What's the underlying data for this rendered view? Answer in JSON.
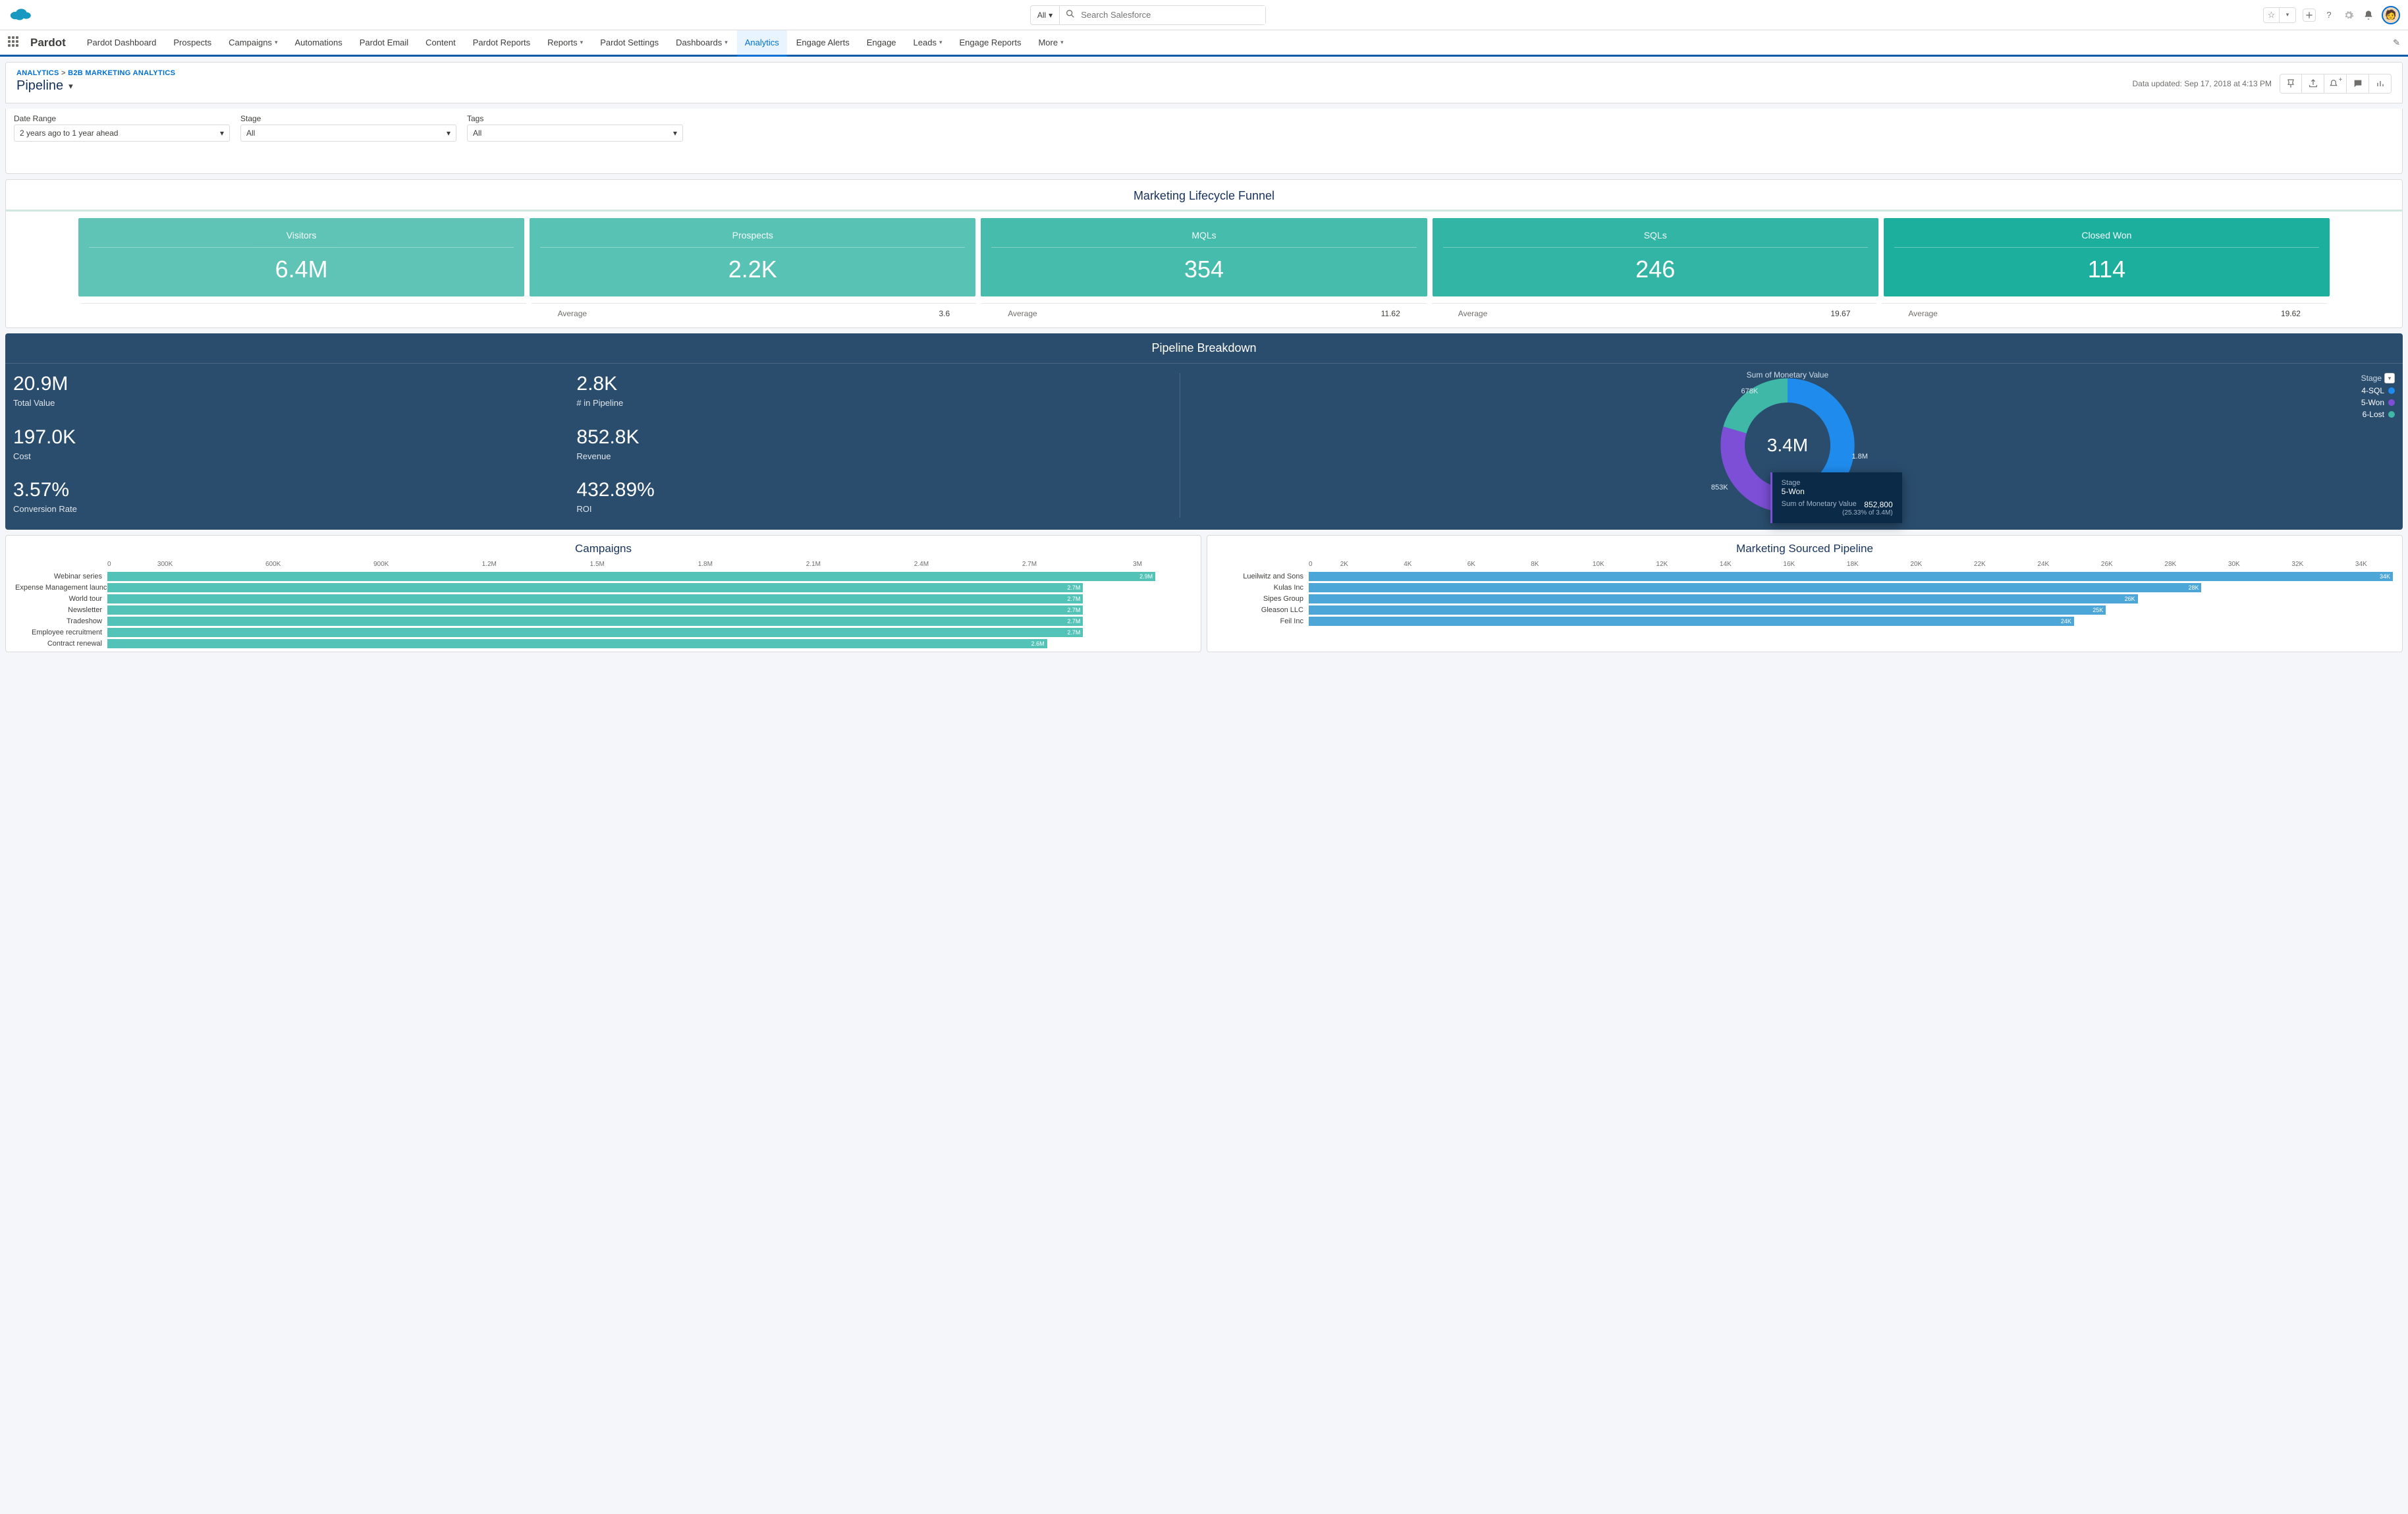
{
  "global_header": {
    "search_scope": "All",
    "search_placeholder": "Search Salesforce"
  },
  "nav": {
    "app_name": "Pardot",
    "items": [
      {
        "label": "Pardot Dashboard",
        "dd": false
      },
      {
        "label": "Prospects",
        "dd": false
      },
      {
        "label": "Campaigns",
        "dd": true
      },
      {
        "label": "Automations",
        "dd": false
      },
      {
        "label": "Pardot Email",
        "dd": false
      },
      {
        "label": "Content",
        "dd": false
      },
      {
        "label": "Pardot Reports",
        "dd": false
      },
      {
        "label": "Reports",
        "dd": true
      },
      {
        "label": "Pardot Settings",
        "dd": false
      },
      {
        "label": "Dashboards",
        "dd": true
      },
      {
        "label": "Analytics",
        "dd": false,
        "active": true
      },
      {
        "label": "Engage Alerts",
        "dd": false
      },
      {
        "label": "Engage",
        "dd": false
      },
      {
        "label": "Leads",
        "dd": true
      },
      {
        "label": "Engage Reports",
        "dd": false
      },
      {
        "label": "More",
        "dd": true
      }
    ]
  },
  "dash_head": {
    "crumb1": "ANALYTICS",
    "crumb2": "B2B MARKETING ANALYTICS",
    "title": "Pipeline",
    "updated": "Data updated: Sep 17, 2018 at 4:13 PM"
  },
  "filters": {
    "date_range": {
      "label": "Date Range",
      "value": "2 years ago to 1 year ahead"
    },
    "stage": {
      "label": "Stage",
      "value": "All"
    },
    "tags": {
      "label": "Tags",
      "value": "All"
    }
  },
  "funnel": {
    "title": "Marketing Lifecycle Funnel",
    "cards": [
      {
        "label": "Visitors",
        "value": "6.4M"
      },
      {
        "label": "Prospects",
        "value": "2.2K"
      },
      {
        "label": "MQLs",
        "value": "354"
      },
      {
        "label": "SQLs",
        "value": "246"
      },
      {
        "label": "Closed Won",
        "value": "114"
      }
    ],
    "avg_label": "Average",
    "averages": [
      "3.6",
      "11.62",
      "19.67",
      "19.62"
    ]
  },
  "pipeline": {
    "title": "Pipeline Breakdown",
    "stats": [
      {
        "big": "20.9M",
        "sm": "Total Value"
      },
      {
        "big": "2.8K",
        "sm": "# in Pipeline"
      },
      {
        "big": "197.0K",
        "sm": "Cost"
      },
      {
        "big": "852.8K",
        "sm": "Revenue"
      },
      {
        "big": "3.57%",
        "sm": "Conversion Rate"
      },
      {
        "big": "432.89%",
        "sm": "ROI"
      }
    ],
    "donut_title": "Sum of Monetary Value",
    "donut_center": "3.4M",
    "donut_labels": {
      "sql": "1.8M",
      "won": "853K",
      "lost": "678K"
    },
    "legend_title": "Stage",
    "legend": [
      {
        "label": "4-SQL",
        "color": "#1f8ced"
      },
      {
        "label": "5-Won",
        "color": "#7d4fd6"
      },
      {
        "label": "6-Lost",
        "color": "#3fb8a7"
      }
    ],
    "tooltip": {
      "stage_label": "Stage",
      "stage_value": "5-Won",
      "metric_label": "Sum of Monetary Value",
      "metric_value": "852,800",
      "pct": "(25.33% of 3.4M)"
    }
  },
  "chart_data": {
    "donut": {
      "type": "pie",
      "title": "Sum of Monetary Value",
      "total": "3.4M",
      "series": [
        {
          "name": "4-SQL",
          "value": 1800000,
          "label": "1.8M",
          "color": "#1f8ced"
        },
        {
          "name": "5-Won",
          "value": 853000,
          "label": "853K",
          "color": "#7d4fd6"
        },
        {
          "name": "6-Lost",
          "value": 678000,
          "label": "678K",
          "color": "#3fb8a7"
        }
      ]
    },
    "campaigns": {
      "type": "bar",
      "title": "Campaigns",
      "xticks": [
        "0",
        "300K",
        "600K",
        "900K",
        "1.2M",
        "1.5M",
        "1.8M",
        "2.1M",
        "2.4M",
        "2.7M",
        "3M"
      ],
      "xmax": 3000000,
      "rows": [
        {
          "label": "Webinar series",
          "value": 2900000,
          "display": "2.9M"
        },
        {
          "label": "Expense Management launch",
          "value": 2700000,
          "display": "2.7M"
        },
        {
          "label": "World tour",
          "value": 2700000,
          "display": "2.7M"
        },
        {
          "label": "Newsletter",
          "value": 2700000,
          "display": "2.7M"
        },
        {
          "label": "Tradeshow",
          "value": 2700000,
          "display": "2.7M"
        },
        {
          "label": "Employee recruitment",
          "value": 2700000,
          "display": "2.7M"
        },
        {
          "label": "Contract renewal",
          "value": 2600000,
          "display": "2.6M"
        }
      ]
    },
    "msp": {
      "type": "bar",
      "title": "Marketing Sourced Pipeline",
      "xticks": [
        "0",
        "2K",
        "4K",
        "6K",
        "8K",
        "10K",
        "12K",
        "14K",
        "16K",
        "18K",
        "20K",
        "22K",
        "24K",
        "26K",
        "28K",
        "30K",
        "32K",
        "34K"
      ],
      "xmax": 34000,
      "rows": [
        {
          "label": "Lueilwitz and Sons",
          "value": 34000,
          "display": "34K"
        },
        {
          "label": "Kulas Inc",
          "value": 28000,
          "display": "28K"
        },
        {
          "label": "Sipes Group",
          "value": 26000,
          "display": "26K"
        },
        {
          "label": "Gleason LLC",
          "value": 25000,
          "display": "25K"
        },
        {
          "label": "Feil Inc",
          "value": 24000,
          "display": "24K"
        }
      ]
    }
  }
}
